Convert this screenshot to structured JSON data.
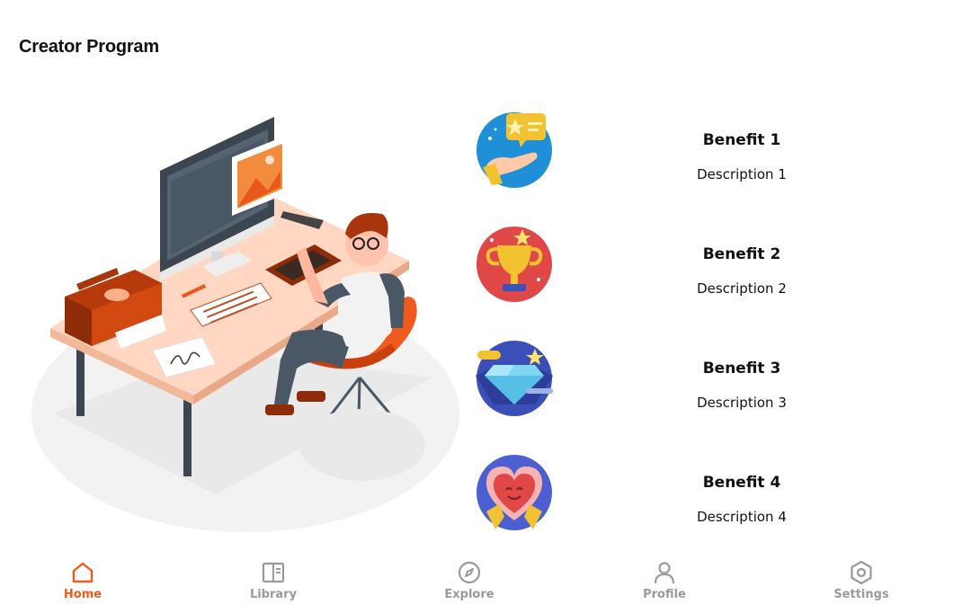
{
  "page": {
    "title": "Creator Program"
  },
  "benefits": [
    {
      "title": "Benefit 1",
      "description": "Description 1",
      "icon": "hand-stars-icon"
    },
    {
      "title": "Benefit 2",
      "description": "Description 2",
      "icon": "trophy-icon"
    },
    {
      "title": "Benefit 3",
      "description": "Description 3",
      "icon": "diamond-icon"
    },
    {
      "title": "Benefit 4",
      "description": "Description 4",
      "icon": "heart-icon"
    }
  ],
  "nav": {
    "items": [
      {
        "label": "Home",
        "icon": "home-icon",
        "active": true
      },
      {
        "label": "Library",
        "icon": "library-icon",
        "active": false
      },
      {
        "label": "Explore",
        "icon": "compass-icon",
        "active": false
      },
      {
        "label": "Profile",
        "icon": "profile-icon",
        "active": false
      },
      {
        "label": "Settings",
        "icon": "settings-icon",
        "active": false
      }
    ]
  },
  "colors": {
    "accent": "#f15a1d",
    "inactive": "#9a9a9a",
    "text": "#111111"
  }
}
